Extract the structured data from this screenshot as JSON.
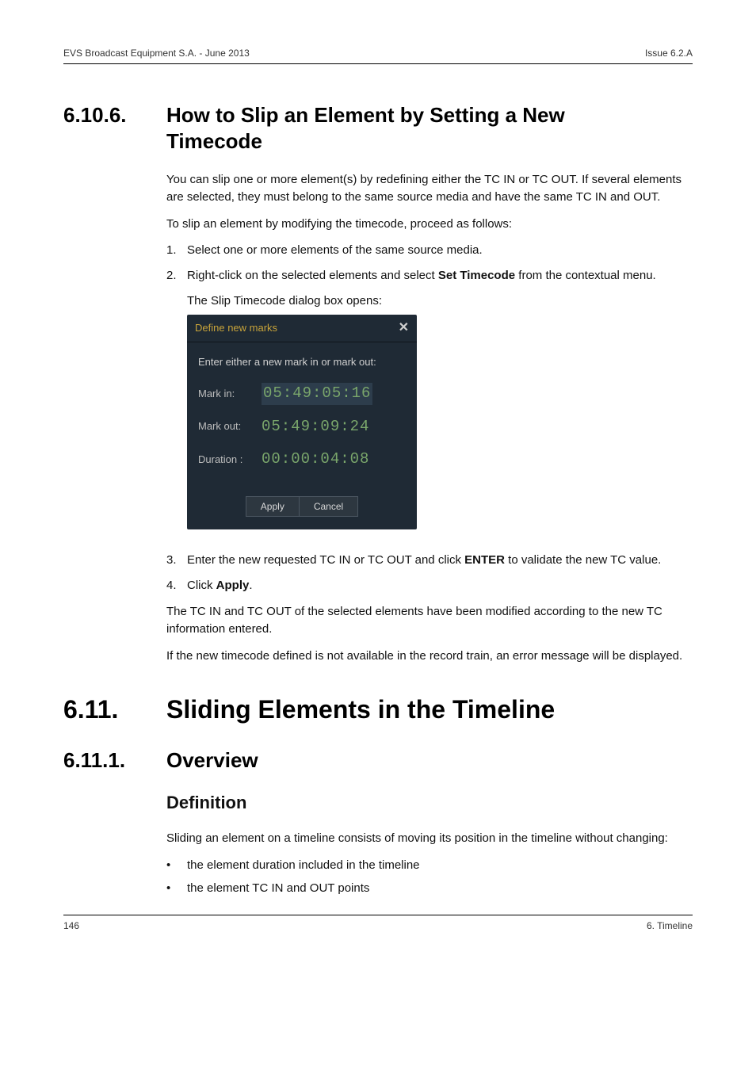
{
  "header": {
    "left": "EVS Broadcast Equipment S.A.  -  June 2013",
    "right": "Issue 6.2.A"
  },
  "footer": {
    "left": "146",
    "right": "6. Timeline"
  },
  "s6106": {
    "num": "6.10.6.",
    "title_l1": "How to Slip an Element by Setting a New",
    "title_l2": "Timecode",
    "intro": "You can slip one or more element(s) by redefining either the TC IN or TC OUT. If several elements are selected, they must belong to the same source media and have the same TC IN and OUT.",
    "lead": "To slip an element by modifying the timecode, proceed as follows:",
    "step1_num": "1.",
    "step1": "Select one or more elements of the same source media.",
    "step2_num": "2.",
    "step2_a": "Right-click on the selected elements and select ",
    "step2_b": "Set Timecode",
    "step2_c": " from the contextual menu.",
    "step2_sub": "The Slip Timecode dialog box opens:",
    "step3_num": "3.",
    "step3_a": "Enter the new requested TC IN or TC OUT and click ",
    "step3_b": "ENTER",
    "step3_c": " to validate the new TC value.",
    "step4_num": "4.",
    "step4_a": "Click ",
    "step4_b": "Apply",
    "step4_c": ".",
    "after1": "The TC IN and TC OUT of the selected elements have been modified according to the new TC information entered.",
    "after2": "If the new timecode defined is not available in the record train, an error message will be displayed."
  },
  "dialog": {
    "title": "Define new marks",
    "prompt": "Enter either a new mark in or mark out:",
    "mark_in_label": "Mark in:",
    "mark_in_value": "05:49:05:16",
    "mark_out_label": "Mark out:",
    "mark_out_value": "05:49:09:24",
    "duration_label": "Duration :",
    "duration_value": "00:00:04:08",
    "apply": "Apply",
    "cancel": "Cancel"
  },
  "s611": {
    "num": "6.11.",
    "title": "Sliding Elements in the Timeline"
  },
  "s6111": {
    "num": "6.11.1.",
    "title": "Overview",
    "subhead": "Definition",
    "para": "Sliding an element on a timeline consists of moving its position in the timeline without changing:",
    "b1": "the element duration included in the timeline",
    "b2": "the element TC IN and OUT points",
    "dot": "•"
  }
}
